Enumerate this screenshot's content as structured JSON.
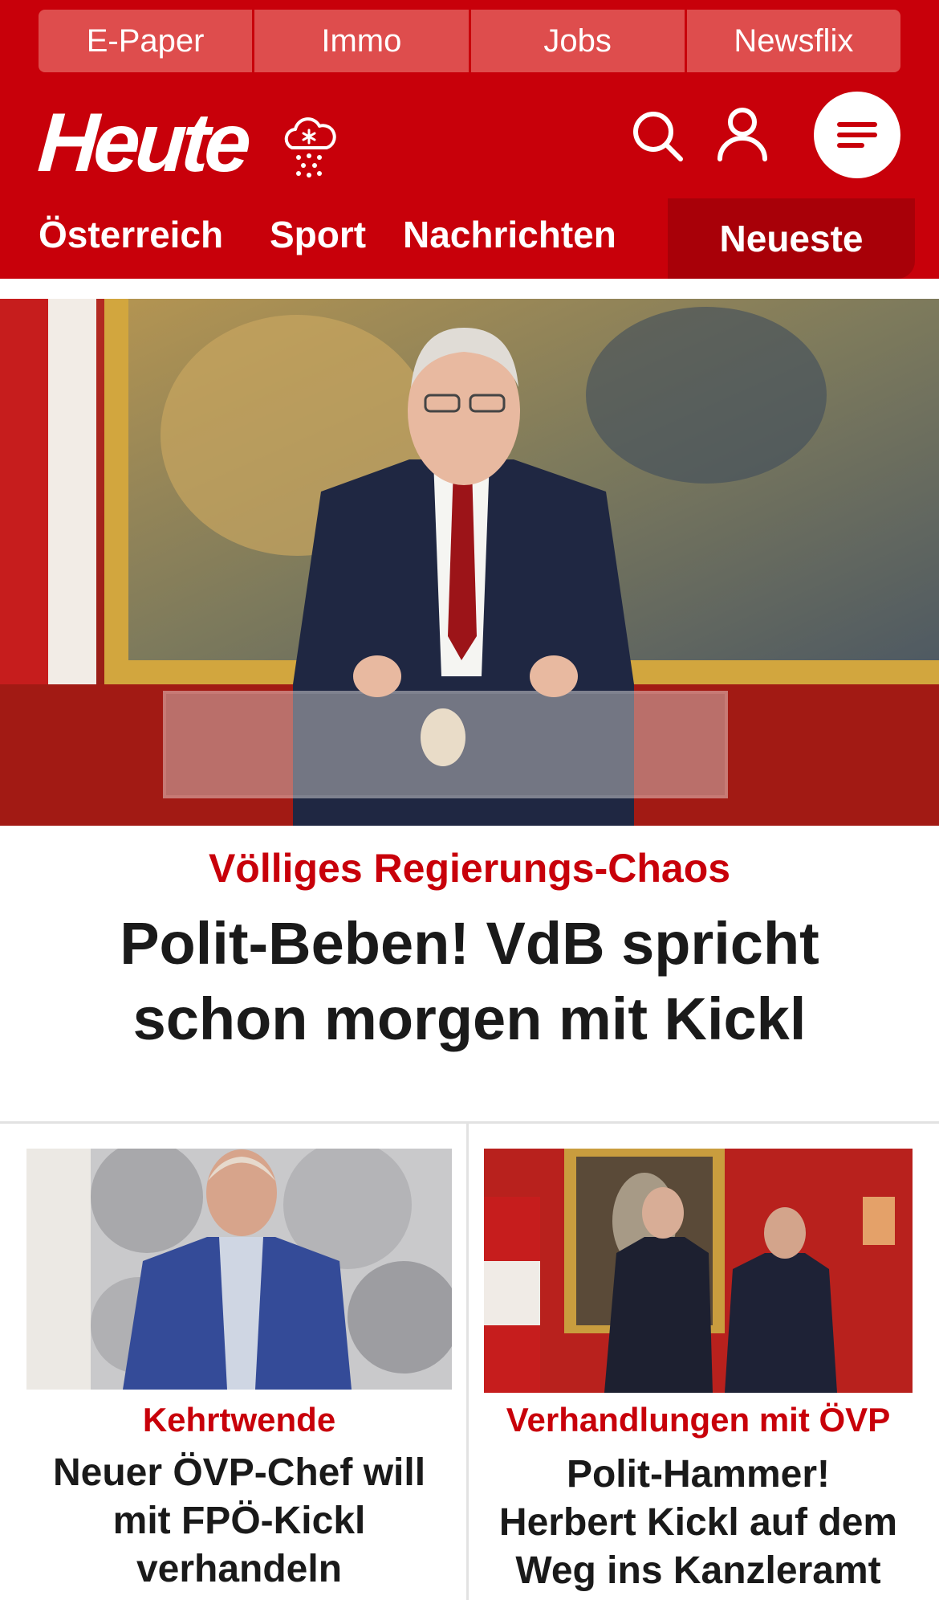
{
  "top_nav": [
    "E-Paper",
    "Immo",
    "Jobs",
    "Newsflix"
  ],
  "brand": {
    "logo": "Heute",
    "accent_color": "#c8000a"
  },
  "header_icons": [
    "weather-snow-icon",
    "search-icon",
    "user-icon",
    "menu-icon"
  ],
  "section_nav": [
    "Österreich",
    "Sport",
    "Nachrichten",
    "Neueste"
  ],
  "hero": {
    "kicker": "Völliges Regierungs-Chaos",
    "title": "Polit-Beben! VdB spricht schon morgen mit Kickl"
  },
  "teasers": [
    {
      "kicker": "Kehrtwende",
      "title_lines": [
        "Neuer ÖVP-Chef will",
        "mit FPÖ-Kickl",
        "verhandeln"
      ]
    },
    {
      "kicker": "Verhandlungen mit ÖVP",
      "title_lines": [
        "Polit-Hammer!",
        "Herbert Kickl auf dem",
        "Weg ins Kanzleramt"
      ]
    }
  ]
}
